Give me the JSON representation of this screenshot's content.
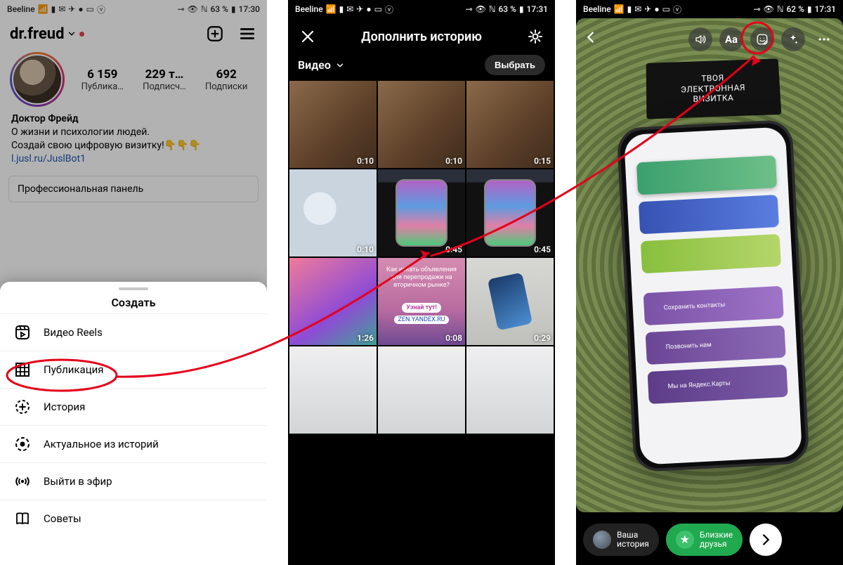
{
  "status": {
    "carrier": "Beeline",
    "left_icons": [
      "5G",
      "signal",
      "mail",
      "telegram",
      "circle",
      "msg",
      "vk"
    ],
    "right_icons": [
      "key",
      "eye",
      "nfc"
    ],
    "battery1": "63 %",
    "battery2": "63 %",
    "battery3": "62 %",
    "time1": "17:30",
    "time2": "17:31",
    "time3": "17:31"
  },
  "screen1": {
    "username": "dr.freud",
    "stats": {
      "posts_n": "6 159",
      "posts_l": "Публика…",
      "followers_n": "229 т…",
      "followers_l": "Подписч…",
      "following_n": "692",
      "following_l": "Подписки"
    },
    "bio": {
      "name": "Доктор Фрейд",
      "line1": "О жизни и психологии людей.",
      "line2": "Создай свою цифровую визитку!👇👇👇",
      "link": "l.jusl.ru/JuslBot1"
    },
    "panel": "Профессиональная панель",
    "sheet": {
      "title": "Создать",
      "items": [
        {
          "icon": "reels-icon",
          "label": "Видео Reels"
        },
        {
          "icon": "grid-icon",
          "label": "Публикация"
        },
        {
          "icon": "story-plus-icon",
          "label": "История"
        },
        {
          "icon": "highlight-icon",
          "label": "Актуальное из историй"
        },
        {
          "icon": "live-icon",
          "label": "Выйти в эфир"
        },
        {
          "icon": "guide-icon",
          "label": "Советы"
        }
      ]
    }
  },
  "screen2": {
    "title": "Дополнить историю",
    "album": "Видео",
    "select": "Выбрать",
    "thumbs": [
      {
        "klass": "wood",
        "dur": "0:10"
      },
      {
        "klass": "wood",
        "dur": "0:10"
      },
      {
        "klass": "wood",
        "dur": "0:15"
      },
      {
        "klass": "badge-bg",
        "dur": "0:10"
      },
      {
        "klass": "phoneimg",
        "dur": "0:45"
      },
      {
        "klass": "phoneimg",
        "dur": "0:45"
      },
      {
        "klass": "apps-bg",
        "dur": "1:26"
      },
      {
        "klass": "ad-bg",
        "dur": "0:08",
        "ad_text": "Как искать объявления для перепродажи на вторичном рынке?",
        "ad_pill": "Узнай тут!",
        "ad_zen": "ZEN.YANDEX.RU"
      },
      {
        "klass": "paper-bg",
        "dur": "0:29"
      },
      {
        "klass": "snow",
        "dur": ""
      },
      {
        "klass": "snow",
        "dur": ""
      },
      {
        "klass": "snow",
        "dur": ""
      }
    ]
  },
  "screen3": {
    "card_l1": "ТВОЯ",
    "card_l2": "ЭЛЕКТРОННАЯ",
    "card_l3": "ВИЗИТКА",
    "bars": {
      "b4": "Сохранить контакты",
      "b5": "Позвонить нам",
      "b6": "Мы на Яндекс.Карты"
    },
    "chips": {
      "your_l1": "Ваша",
      "your_l2": "история",
      "close_l1": "Близкие",
      "close_l2": "друзья"
    },
    "text_tool": "Aa"
  },
  "annotation": {
    "color": "#e4001a"
  }
}
